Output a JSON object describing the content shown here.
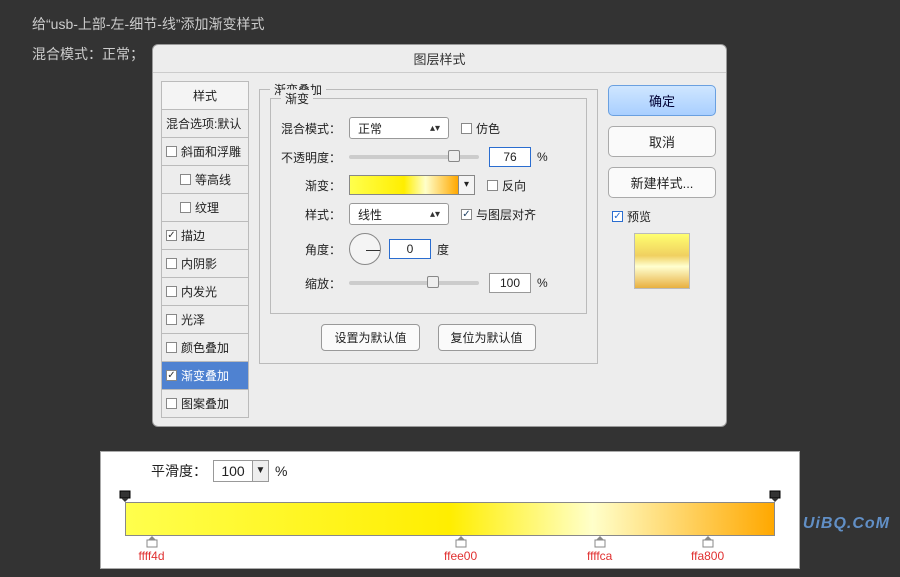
{
  "desc": "给“usb-上部-左-细节-线”添加渐变样式",
  "blend_label": "混合模式：正常；",
  "dialog_title": "图层样式",
  "styles_header": "样式",
  "styles_default": "混合选项:默认",
  "style_items": [
    {
      "label": "斜面和浮雕",
      "checked": false,
      "indent": false
    },
    {
      "label": "等高线",
      "checked": false,
      "indent": true
    },
    {
      "label": "纹理",
      "checked": false,
      "indent": true
    },
    {
      "label": "描边",
      "checked": true,
      "indent": false
    },
    {
      "label": "内阴影",
      "checked": false,
      "indent": false
    },
    {
      "label": "内发光",
      "checked": false,
      "indent": false
    },
    {
      "label": "光泽",
      "checked": false,
      "indent": false
    },
    {
      "label": "颜色叠加",
      "checked": false,
      "indent": false
    },
    {
      "label": "渐变叠加",
      "checked": true,
      "indent": false,
      "selected": true
    },
    {
      "label": "图案叠加",
      "checked": false,
      "indent": false
    }
  ],
  "group_title": "渐变叠加",
  "inner_title": "渐变",
  "labels": {
    "blend": "混合模式：",
    "opacity": "不透明度：",
    "gradient": "渐变：",
    "style": "样式：",
    "angle": "角度：",
    "scale": "缩放："
  },
  "blend_value": "正常",
  "dither": "仿色",
  "opacity_value": "76",
  "percent": "%",
  "reverse": "反向",
  "style_value": "线性",
  "align": "与图层对齐",
  "angle_value": "0",
  "angle_unit": "度",
  "scale_value": "100",
  "btn_set_default": "设置为默认值",
  "btn_reset_default": "复位为默认值",
  "btn_ok": "确定",
  "btn_cancel": "取消",
  "btn_new": "新建样式...",
  "preview": "预览",
  "smooth_label": "平滑度：",
  "smooth_value": "100",
  "color_stops": [
    {
      "hex": "ffff4d",
      "pos": 3
    },
    {
      "hex": "ffee00",
      "pos": 50
    },
    {
      "hex": "ffffca",
      "pos": 72
    },
    {
      "hex": "ffa800",
      "pos": 88
    }
  ],
  "opacity_stops": [
    0,
    100
  ],
  "watermark": "UiBQ.CoM",
  "chart_data": {
    "type": "gradient",
    "stops": [
      {
        "color": "#ffff4d",
        "position_pct": 3
      },
      {
        "color": "#ffee00",
        "position_pct": 50
      },
      {
        "color": "#ffffca",
        "position_pct": 72
      },
      {
        "color": "#ffa800",
        "position_pct": 88
      }
    ],
    "opacity_stops": [
      {
        "opacity_pct": 100,
        "position_pct": 0
      },
      {
        "opacity_pct": 100,
        "position_pct": 100
      }
    ],
    "smoothness_pct": 100
  }
}
